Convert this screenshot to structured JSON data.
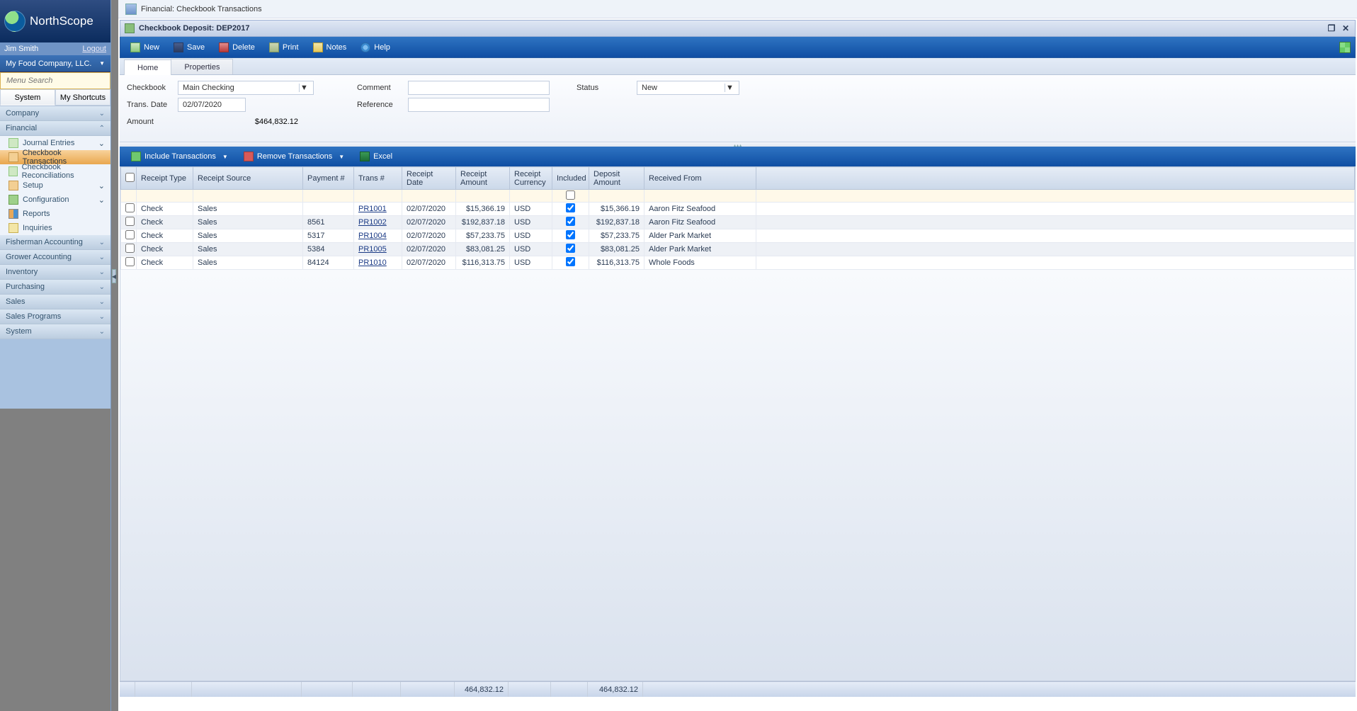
{
  "app": {
    "brand": "NorthScope",
    "user": "Jim Smith",
    "logout": "Logout",
    "company": "My Food Company, LLC.",
    "menu_search_placeholder": "Menu Search"
  },
  "navtabs": {
    "system": "System",
    "shortcuts": "My Shortcuts"
  },
  "nav": {
    "company": "Company",
    "financial": "Financial",
    "financial_items": {
      "je": "Journal Entries",
      "ct": "Checkbook Transactions",
      "cr": "Checkbook Reconciliations",
      "setup": "Setup",
      "config": "Configuration",
      "reports": "Reports",
      "inq": "Inquiries"
    },
    "fisherman": "Fisherman Accounting",
    "grower": "Grower Accounting",
    "inventory": "Inventory",
    "purchasing": "Purchasing",
    "sales": "Sales",
    "salesprog": "Sales Programs",
    "system": "System"
  },
  "titlebar": "Financial: Checkbook Transactions",
  "window": {
    "title": "Checkbook Deposit: DEP2017"
  },
  "toolbar": {
    "new": "New",
    "save": "Save",
    "delete": "Delete",
    "print": "Print",
    "notes": "Notes",
    "help": "Help"
  },
  "tabs": {
    "home": "Home",
    "properties": "Properties"
  },
  "form": {
    "checkbook_label": "Checkbook",
    "checkbook_value": "Main Checking",
    "transdate_label": "Trans. Date",
    "transdate_value": "02/07/2020",
    "amount_label": "Amount",
    "amount_value": "$464,832.12",
    "comment_label": "Comment",
    "comment_value": "",
    "reference_label": "Reference",
    "reference_value": "",
    "status_label": "Status",
    "status_value": "New"
  },
  "gridtb": {
    "include": "Include Transactions",
    "remove": "Remove Transactions",
    "excel": "Excel"
  },
  "cols": {
    "c0": "",
    "c1": "Receipt Type",
    "c2": "Receipt Source",
    "c3": "Payment #",
    "c4": "Trans #",
    "c5": "Receipt Date",
    "c6": "Receipt Amount",
    "c7": "Receipt Currency",
    "c8": "Included",
    "c9": "Deposit Amount",
    "c10": "Received From"
  },
  "rows": [
    {
      "type": "Check",
      "source": "Sales",
      "payment": "",
      "trans": "PR1001",
      "date": "02/07/2020",
      "ramount": "$15,366.19",
      "curr": "USD",
      "incl": true,
      "damount": "$15,366.19",
      "from": "Aaron Fitz Seafood"
    },
    {
      "type": "Check",
      "source": "Sales",
      "payment": "8561",
      "trans": "PR1002",
      "date": "02/07/2020",
      "ramount": "$192,837.18",
      "curr": "USD",
      "incl": true,
      "damount": "$192,837.18",
      "from": "Aaron Fitz Seafood"
    },
    {
      "type": "Check",
      "source": "Sales",
      "payment": "5317",
      "trans": "PR1004",
      "date": "02/07/2020",
      "ramount": "$57,233.75",
      "curr": "USD",
      "incl": true,
      "damount": "$57,233.75",
      "from": "Alder Park Market"
    },
    {
      "type": "Check",
      "source": "Sales",
      "payment": "5384",
      "trans": "PR1005",
      "date": "02/07/2020",
      "ramount": "$83,081.25",
      "curr": "USD",
      "incl": true,
      "damount": "$83,081.25",
      "from": "Alder Park Market"
    },
    {
      "type": "Check",
      "source": "Sales",
      "payment": "84124",
      "trans": "PR1010",
      "date": "02/07/2020",
      "ramount": "$116,313.75",
      "curr": "USD",
      "incl": true,
      "damount": "$116,313.75",
      "from": "Whole Foods"
    }
  ],
  "footer": {
    "ramount_total": "464,832.12",
    "damount_total": "464,832.12"
  }
}
